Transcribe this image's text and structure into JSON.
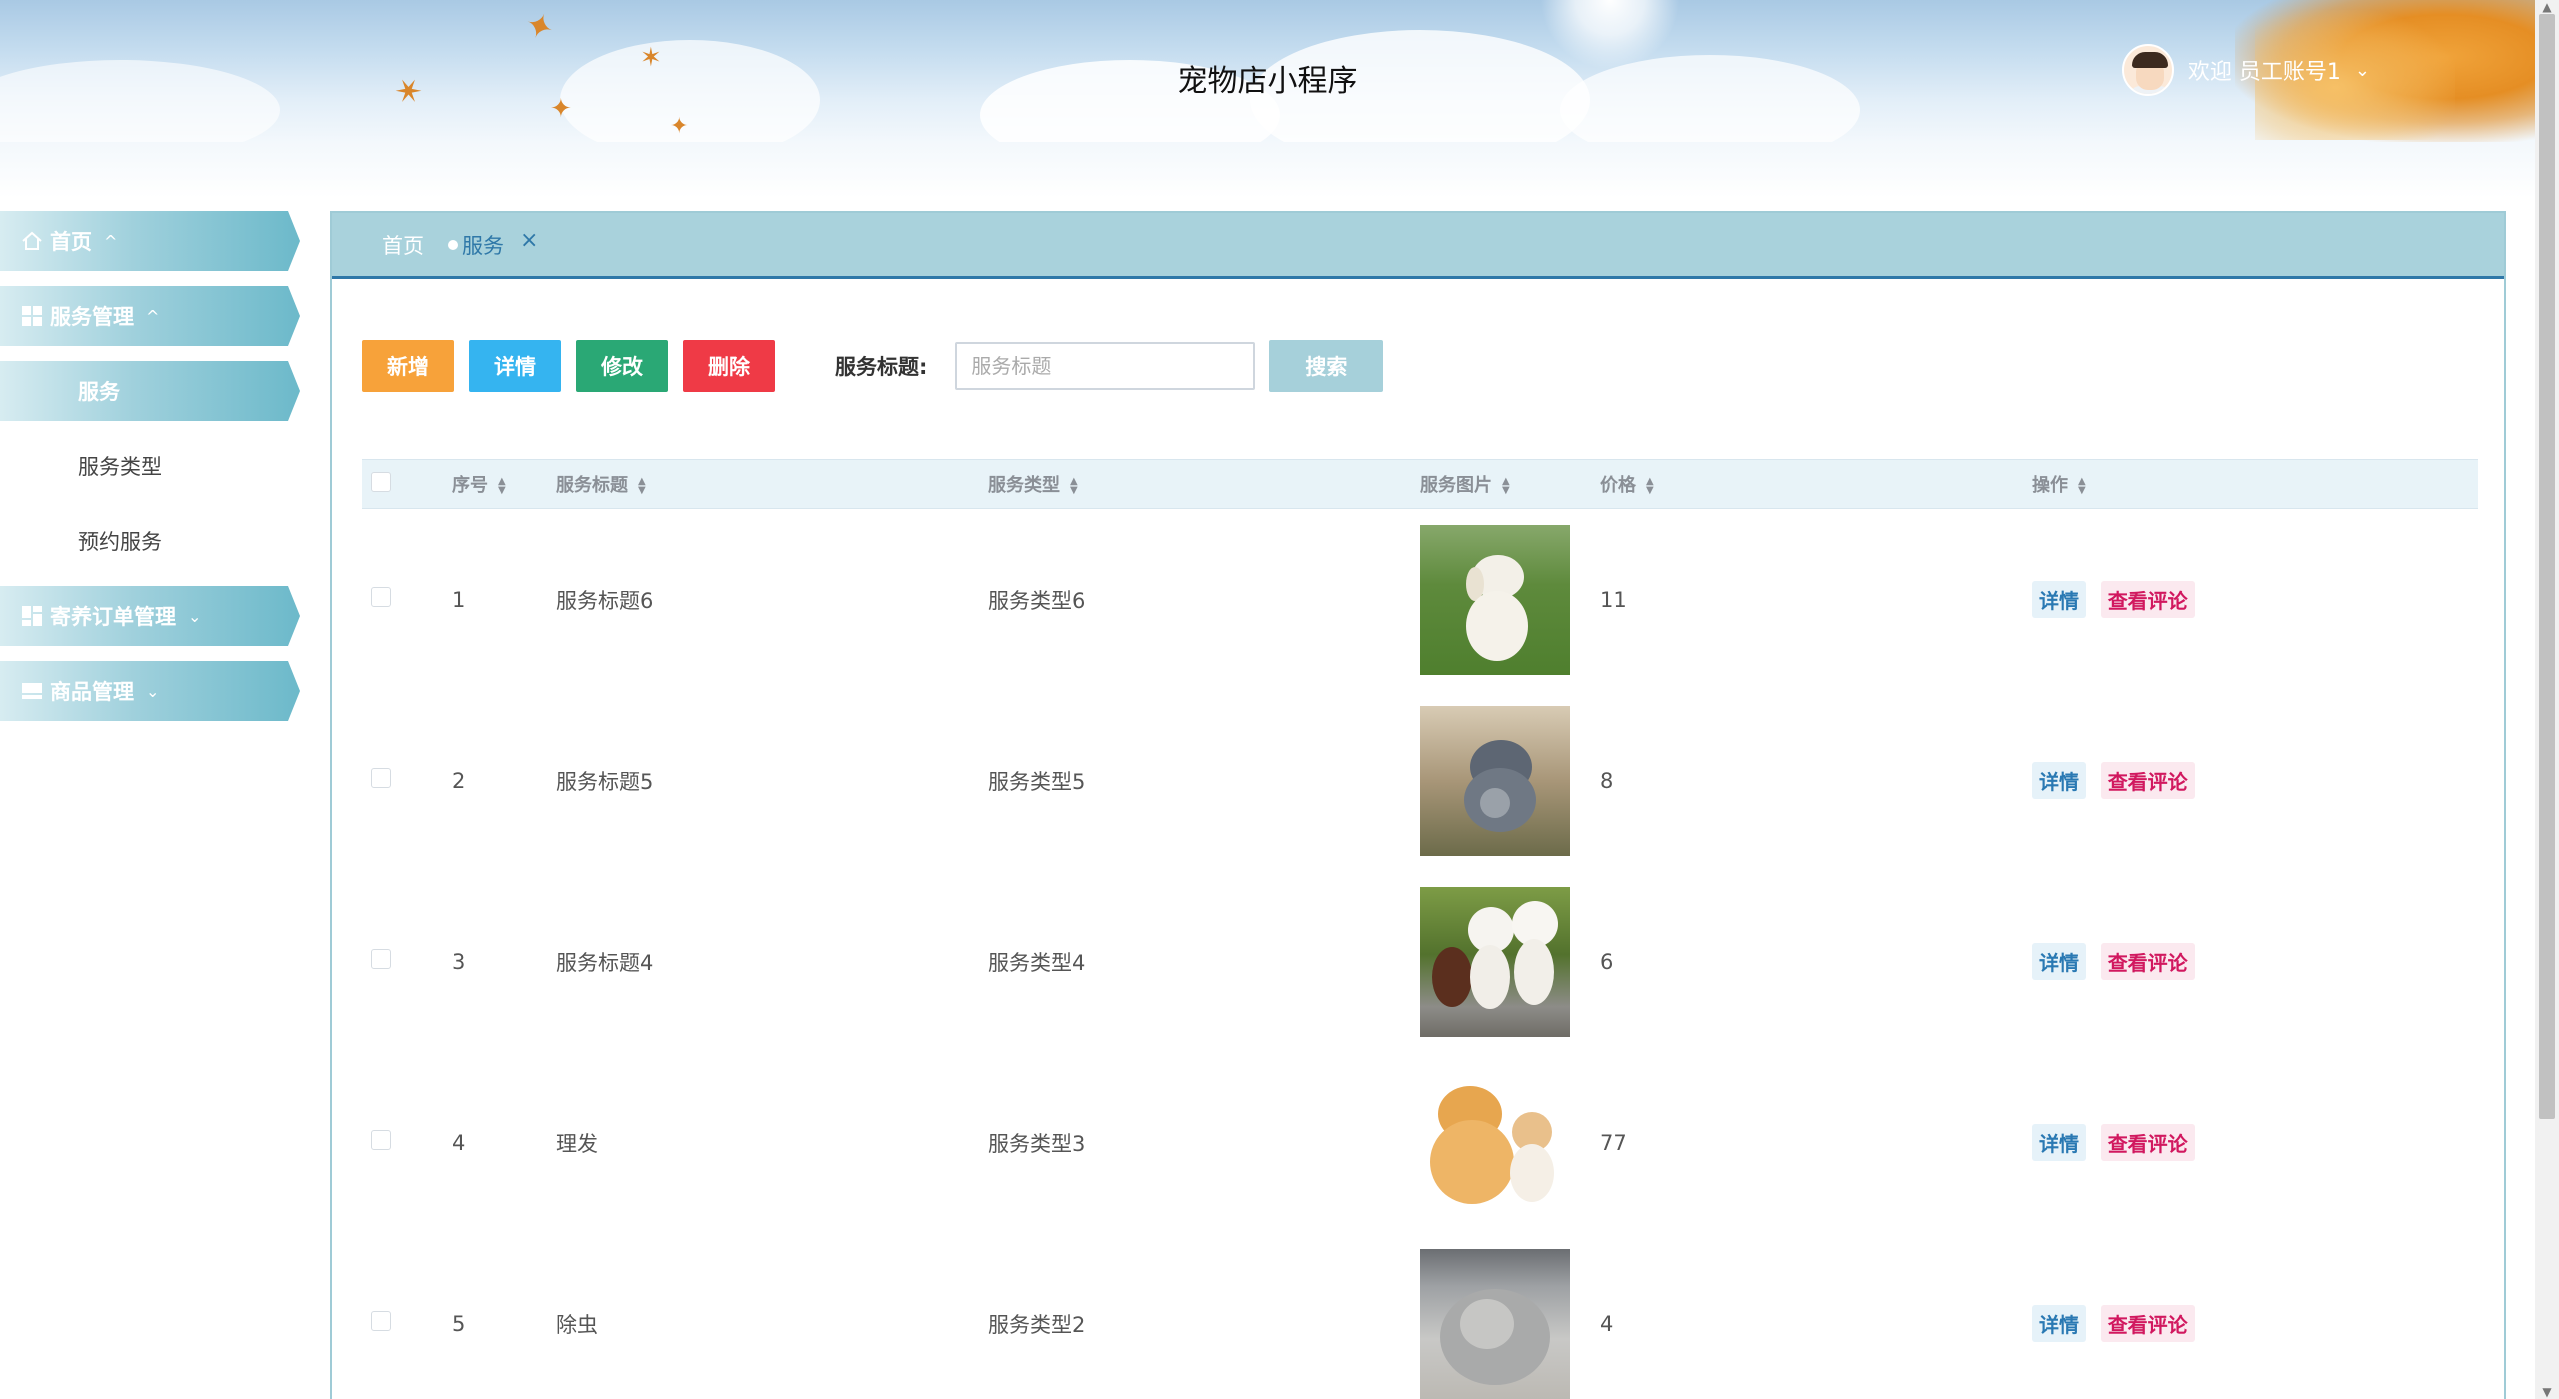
{
  "header": {
    "title": "宠物店小程序",
    "welcome": "欢迎 员工账号1"
  },
  "sidebar": {
    "items": [
      {
        "label": "首页",
        "icon": "home-icon"
      },
      {
        "label": "服务管理",
        "icon": "grid-icon"
      },
      {
        "label": "服务"
      },
      {
        "label": "服务类型"
      },
      {
        "label": "预约服务"
      },
      {
        "label": "寄养订单管理",
        "icon": "grid-icon"
      },
      {
        "label": "商品管理",
        "icon": "panel-icon"
      }
    ]
  },
  "tabs": {
    "home": "首页",
    "active": "服务",
    "close": "×"
  },
  "toolbar": {
    "add": "新增",
    "detail": "详情",
    "edit": "修改",
    "delete": "删除",
    "search_label": "服务标题:",
    "search_placeholder": "服务标题",
    "search_button": "搜索"
  },
  "table": {
    "columns": [
      "序号",
      "服务标题",
      "服务类型",
      "服务图片",
      "价格",
      "操作"
    ],
    "rows": [
      {
        "idx": "1",
        "title": "服务标题6",
        "type": "服务类型6",
        "image": "white puppy on grass",
        "price": "11"
      },
      {
        "idx": "2",
        "title": "服务标题5",
        "type": "服务类型5",
        "image": "grey chinchilla",
        "price": "8"
      },
      {
        "idx": "3",
        "title": "服务标题4",
        "type": "服务类型4",
        "image": "three poodles",
        "price": "6"
      },
      {
        "idx": "4",
        "title": "理发",
        "type": "服务类型3",
        "image": "pomeranian and kitten",
        "price": "77"
      },
      {
        "idx": "5",
        "title": "除虫",
        "type": "服务类型2",
        "image": "grey chinchilla",
        "price": "4"
      }
    ],
    "op_detail": "详情",
    "op_review": "查看评论"
  },
  "colors": {
    "add": "#f7a23a",
    "detail": "#35b4f0",
    "edit": "#2aa875",
    "delete": "#ef3a46",
    "search": "#a6d0da",
    "accent": "#2f78a8"
  }
}
